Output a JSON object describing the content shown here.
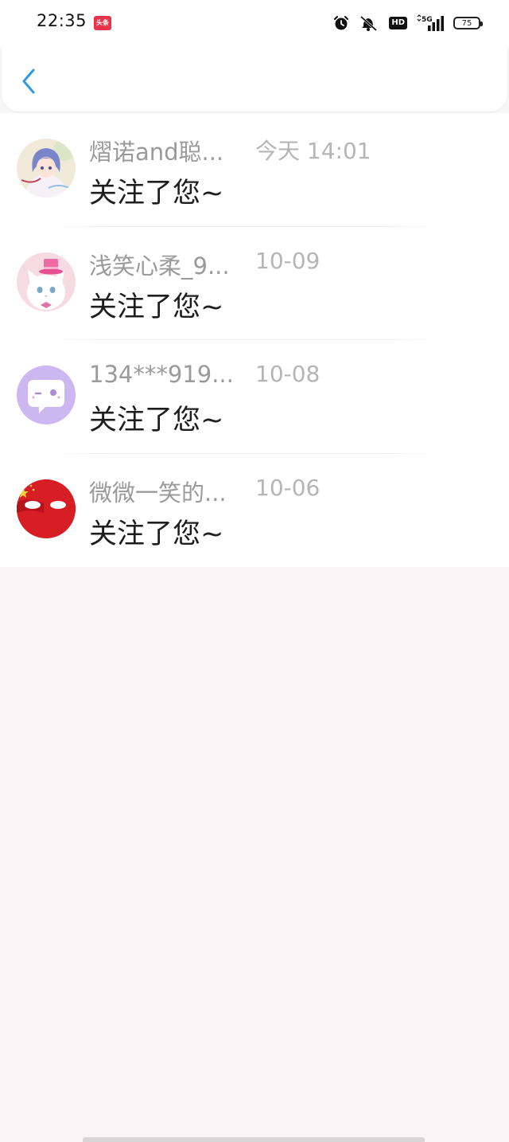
{
  "status_bar": {
    "time": "22:35",
    "app_badge": "头条",
    "battery": "75",
    "hd_label": "HD",
    "network": "5G",
    "icons": [
      "alarm-icon",
      "mute-bell-icon",
      "hd-icon",
      "signal-5g-icon",
      "battery-icon"
    ]
  },
  "header": {
    "back_icon": "chevron-left-icon",
    "accent_color": "#2f9be6"
  },
  "notifications": [
    {
      "user": "熠诺and聪...",
      "time": "今天 14:01",
      "message": "关注了您~",
      "avatar": "anime-girl-avatar"
    },
    {
      "user": "浅笑心柔_9...",
      "time": "10-09",
      "message": "关注了您~",
      "avatar": "white-cat-avatar"
    },
    {
      "user": "134***919...",
      "time": "10-08",
      "message": "关注了您~",
      "avatar": "chat-bubble-avatar"
    },
    {
      "user": "微微一笑的...",
      "time": "10-06",
      "message": "关注了您~",
      "avatar": "red-ball-avatar"
    }
  ]
}
